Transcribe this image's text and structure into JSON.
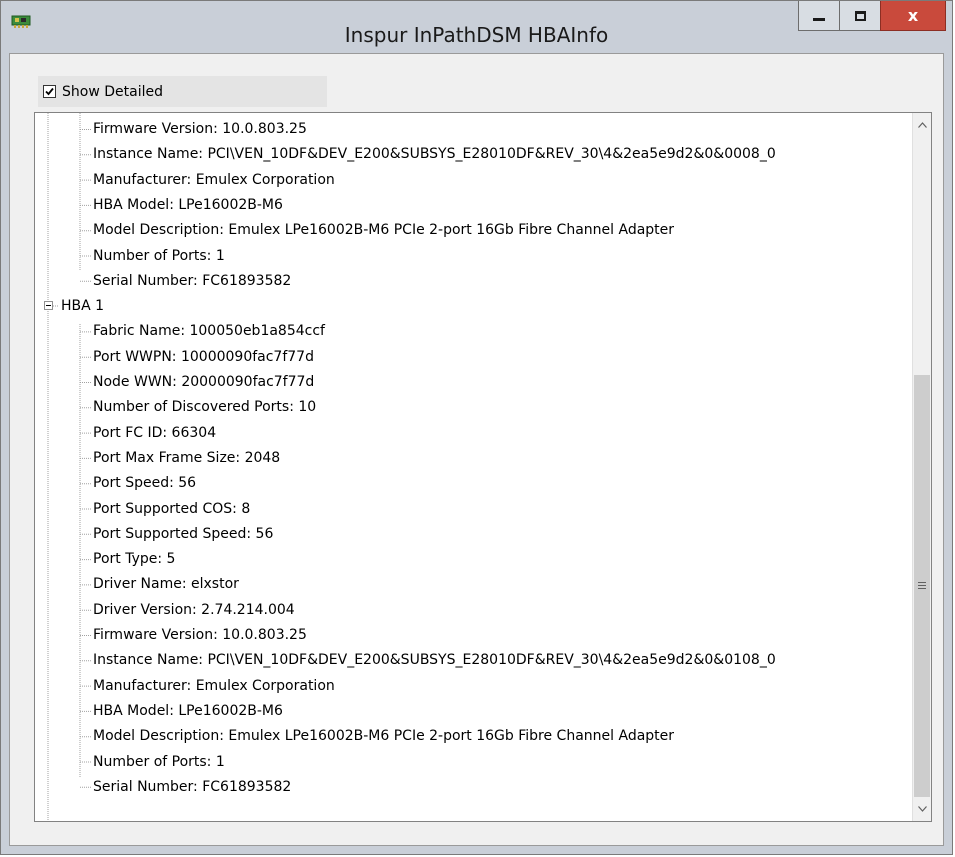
{
  "window": {
    "title": "Inspur InPathDSM HBAInfo",
    "close_glyph": "x",
    "icon": "hba-card-icon"
  },
  "options": {
    "show_detailed_label": "Show Detailed",
    "show_detailed_checked": true
  },
  "tree": {
    "hba0_tail": [
      "Firmware Version: 10.0.803.25",
      "Instance Name: PCI\\VEN_10DF&DEV_E200&SUBSYS_E28010DF&REV_30\\4&2ea5e9d2&0&0008_0",
      "Manufacturer: Emulex Corporation",
      "HBA Model: LPe16002B-M6",
      "Model Description: Emulex LPe16002B-M6 PCIe 2-port 16Gb Fibre Channel Adapter",
      "Number of Ports: 1",
      "Serial Number: FC61893582"
    ],
    "hba1": {
      "label": "HBA 1",
      "expanded": true,
      "children": [
        "Fabric Name: 100050eb1a854ccf",
        "Port WWPN: 10000090fac7f77d",
        "Node WWN: 20000090fac7f77d",
        "Number of Discovered Ports: 10",
        "Port FC ID: 66304",
        "Port Max Frame Size: 2048",
        "Port Speed: 56",
        "Port Supported COS: 8",
        "Port Supported Speed: 56",
        "Port Type: 5",
        "Driver Name: elxstor",
        "Driver Version: 2.74.214.004",
        "Firmware Version: 10.0.803.25",
        "Instance Name: PCI\\VEN_10DF&DEV_E200&SUBSYS_E28010DF&REV_30\\4&2ea5e9d2&0&0108_0",
        "Manufacturer: Emulex Corporation",
        "HBA Model: LPe16002B-M6",
        "Model Description: Emulex LPe16002B-M6 PCIe 2-port 16Gb Fibre Channel Adapter",
        "Number of Ports: 1",
        "Serial Number: FC61893582"
      ]
    }
  },
  "scrollbar": {
    "position_fraction": 0.36,
    "visible_fraction": 0.64
  }
}
